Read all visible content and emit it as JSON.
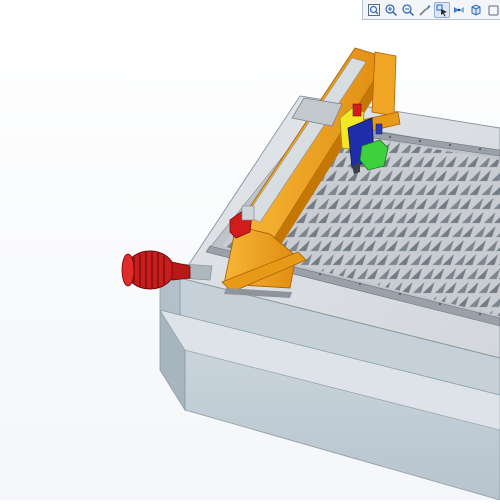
{
  "viewer": {
    "view_mode": "isometric",
    "toolbar": {
      "buttons": [
        {
          "icon": "zoom-fit-icon"
        },
        {
          "icon": "zoom-in-icon"
        },
        {
          "icon": "zoom-out-icon"
        },
        {
          "icon": "repaint-icon"
        },
        {
          "icon": "select-icon",
          "active": true
        },
        {
          "icon": "spin-center-icon"
        },
        {
          "icon": "view-cube-icon"
        },
        {
          "icon": "display-style-icon"
        }
      ]
    }
  },
  "model": {
    "name": "",
    "colors": {
      "base_top": "#d6dbe1",
      "base_side": "#b3c0ca",
      "base_front": "#c8d3db",
      "slat": "#737b84",
      "rail": "#8d949c",
      "gantry": "#f1a21b",
      "gantry_dark": "#c87a08",
      "motor": "#cc1f1f",
      "head_yellow": "#f2e628",
      "head_blue": "#1f2da8",
      "head_green": "#3ed13e"
    }
  }
}
